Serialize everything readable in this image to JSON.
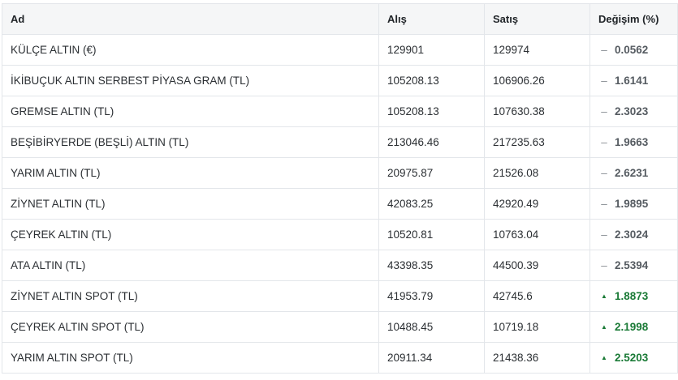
{
  "table": {
    "headers": [
      "Ad",
      "Alış",
      "Satış",
      "Değişim (%)"
    ],
    "rows": [
      {
        "name": "KÜLÇE ALTIN (€)",
        "buy": "129901",
        "sell": "129974",
        "change": "0.0562",
        "trend": "flat",
        "indicator": "–"
      },
      {
        "name": "İKİBUÇUK ALTIN SERBEST PİYASA GRAM (TL)",
        "buy": "105208.13",
        "sell": "106906.26",
        "change": "1.6141",
        "trend": "flat",
        "indicator": "–"
      },
      {
        "name": "GREMSE ALTIN (TL)",
        "buy": "105208.13",
        "sell": "107630.38",
        "change": "2.3023",
        "trend": "flat",
        "indicator": "–"
      },
      {
        "name": "BEŞİBİRYERDE (BEŞLİ) ALTIN (TL)",
        "buy": "213046.46",
        "sell": "217235.63",
        "change": "1.9663",
        "trend": "flat",
        "indicator": "–"
      },
      {
        "name": "YARIM ALTIN (TL)",
        "buy": "20975.87",
        "sell": "21526.08",
        "change": "2.6231",
        "trend": "flat",
        "indicator": "–"
      },
      {
        "name": "ZİYNET ALTIN (TL)",
        "buy": "42083.25",
        "sell": "42920.49",
        "change": "1.9895",
        "trend": "flat",
        "indicator": "–"
      },
      {
        "name": "ÇEYREK ALTIN (TL)",
        "buy": "10520.81",
        "sell": "10763.04",
        "change": "2.3024",
        "trend": "flat",
        "indicator": "–"
      },
      {
        "name": "ATA ALTIN (TL)",
        "buy": "43398.35",
        "sell": "44500.39",
        "change": "2.5394",
        "trend": "flat",
        "indicator": "–"
      },
      {
        "name": "ZİYNET ALTIN SPOT (TL)",
        "buy": "41953.79",
        "sell": "42745.6",
        "change": "1.8873",
        "trend": "up",
        "indicator": "▲"
      },
      {
        "name": "ÇEYREK ALTIN SPOT (TL)",
        "buy": "10488.45",
        "sell": "10719.18",
        "change": "2.1998",
        "trend": "up",
        "indicator": "▲"
      },
      {
        "name": "YARIM ALTIN SPOT (TL)",
        "buy": "20911.34",
        "sell": "21438.36",
        "change": "2.5203",
        "trend": "up",
        "indicator": "▲"
      }
    ]
  },
  "colors": {
    "header_bg": "#f5f6f7",
    "border": "#e3e6ea",
    "up": "#1a7a36",
    "flat": "#555b61"
  }
}
